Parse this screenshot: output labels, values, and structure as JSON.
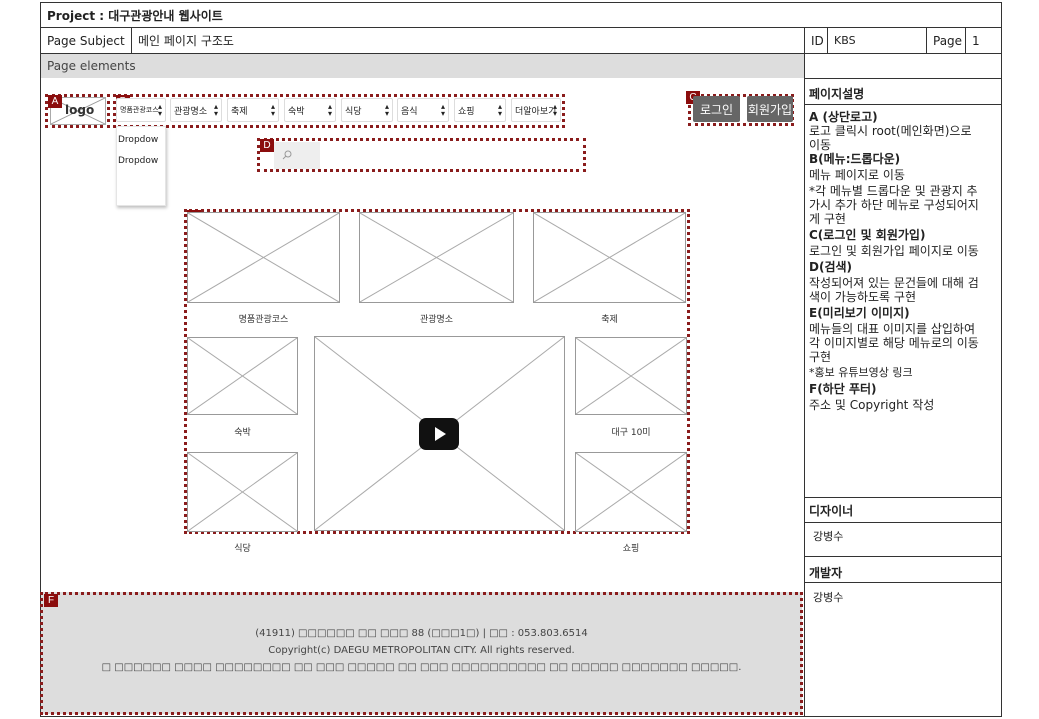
{
  "header": {
    "project": "Project : 대구관광안내 웹사이트",
    "subject_label": "Page Subject",
    "subject_value": "메인 페이지 구조도",
    "id_label": "ID",
    "id_value": "KBS",
    "page_label": "Page",
    "page_value": "1"
  },
  "elements_label": "Page elements",
  "tags": {
    "a": "A",
    "b": "B",
    "c": "C",
    "d": "D",
    "e": "E",
    "f": "F"
  },
  "logo": "logo",
  "menu": [
    "명품관광코스",
    "관광명소",
    "축제",
    "숙박",
    "식당",
    "음식",
    "쇼핑",
    "더알아보기"
  ],
  "dropdown": [
    "Dropdow",
    "Dropdow"
  ],
  "auth": {
    "login": "로그인",
    "signup": "회원가입"
  },
  "search": {
    "icon": "search-icon"
  },
  "preview": {
    "top_captions": [
      "명품관광코스",
      "관광명소",
      "축제"
    ],
    "mid_left": "숙박",
    "mid_right": "대구 10미",
    "bottom_left": "식당",
    "bottom_right": "쇼핑"
  },
  "footer": {
    "line1": "(41911) □□□□□□ □□ □□□ 88 (□□□1□) | □□ : 053.803.6514",
    "line2": "Copyright(c) DAEGU METROPOLITAN CITY. All rights reserved.",
    "line3": "□ □□□□□□ □□□□ □□□□□□□□ □□ □□□ □□□□□ □□ □□□ □□□□□□□□□□ □□ □□□□□ □□□□□□□ □□□□□."
  },
  "sidebar": {
    "title": "페이지설명",
    "items": [
      {
        "head": "A (상단로고)",
        "lines": [
          "로고 클릭시 root(메인화면)으로",
          "이동"
        ]
      },
      {
        "head": "B(메뉴:드롭다운)",
        "lines": [
          "메뉴 페이지로 이동",
          "*각 메뉴별 드롭다운 및 관광지 추",
          "가시 추가 하단 메뉴로 구성되어지",
          "게 구현"
        ]
      },
      {
        "head": "C(로그인 및 회원가입)",
        "lines": [
          "로그인 및 회원가입 페이지로 이동"
        ]
      },
      {
        "head": "D(검색)",
        "lines": [
          "작성되어져 있는 문건들에 대해 검",
          "색이 가능하도록 구현"
        ]
      },
      {
        "head": "E(미리보기 이미지)",
        "lines": [
          "메뉴들의 대표 이미지를 삽입하여",
          "각 이미지별로 해당 메뉴로의 이동",
          "구현",
          "*홍보 유튜브영상 링크"
        ]
      },
      {
        "head": "F(하단 푸터)",
        "lines": [
          "주소 및 Copyright 작성"
        ]
      }
    ],
    "designer_label": "디자이너",
    "designer_name": "강병수",
    "developer_label": "개발자",
    "developer_name": "강병수"
  },
  "colors": {
    "tag": "#8b0d0d",
    "dotted": "#8a1c1c",
    "button": "#666666",
    "footer_bg": "#dddddd",
    "elements_bg": "#dddddd"
  }
}
